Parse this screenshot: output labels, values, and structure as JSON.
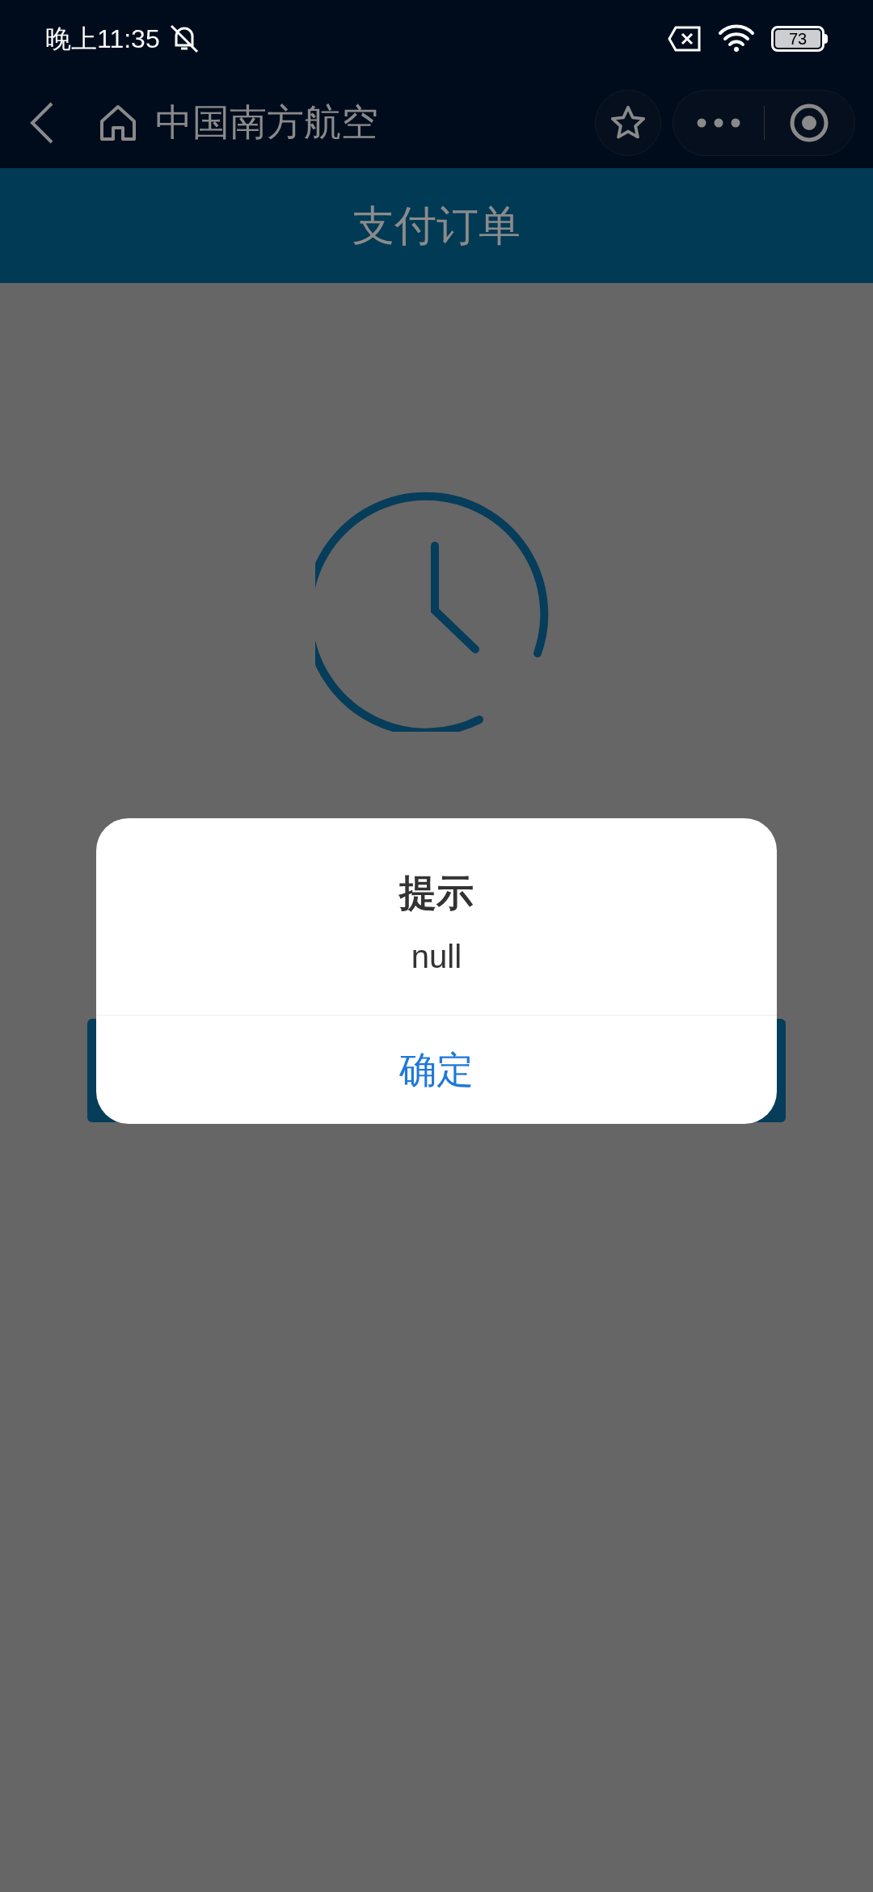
{
  "status_bar": {
    "time": "晚上11:35",
    "battery": "73"
  },
  "nav_bar": {
    "title": "中国南方航空"
  },
  "header": {
    "title": "支付订单"
  },
  "dialog": {
    "title": "提示",
    "message": "null",
    "button": "确定"
  }
}
